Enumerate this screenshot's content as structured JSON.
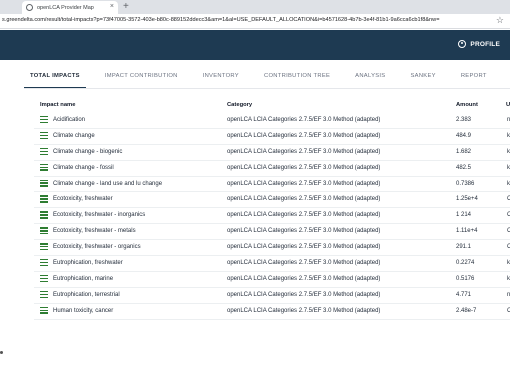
{
  "browser": {
    "tab_title": "openLCA Provider Map",
    "close_glyph": "×",
    "new_tab_glyph": "+",
    "url": "s.greendelta.com/result/total-impacts?p=73f47005-3572-403e-b80c-889152ddecc3&am=1&al=USE_DEFAULT_ALLOCATION&i=b4571628-4b7b-3e4f-81b1-9a6cca6cb1f8&nw=",
    "star_glyph": "☆"
  },
  "header": {
    "profile_label": "PROFILE"
  },
  "tabs": [
    {
      "label": "TOTAL IMPACTS",
      "active": true
    },
    {
      "label": "IMPACT CONTRIBUTION"
    },
    {
      "label": "INVENTORY"
    },
    {
      "label": "CONTRIBUTION TREE"
    },
    {
      "label": "ANALYSIS"
    },
    {
      "label": "SANKEY"
    },
    {
      "label": "REPORT"
    }
  ],
  "table": {
    "columns": [
      "Impact name",
      "Category",
      "Amount",
      "U"
    ],
    "rows": [
      {
        "name": "Acidification",
        "category": "openLCA LCIA Categories 2.7.5/EF 3.0 Method (adapted)",
        "amount": "2.383",
        "unit": "n"
      },
      {
        "name": "Climate change",
        "category": "openLCA LCIA Categories 2.7.5/EF 3.0 Method (adapted)",
        "amount": "484.9",
        "unit": "k"
      },
      {
        "name": "Climate change - biogenic",
        "category": "openLCA LCIA Categories 2.7.5/EF 3.0 Method (adapted)",
        "amount": "1.682",
        "unit": "k"
      },
      {
        "name": "Climate change - fossil",
        "category": "openLCA LCIA Categories 2.7.5/EF 3.0 Method (adapted)",
        "amount": "482.5",
        "unit": "k"
      },
      {
        "name": "Climate change - land use and lu change",
        "category": "openLCA LCIA Categories 2.7.5/EF 3.0 Method (adapted)",
        "amount": "0.7386",
        "unit": "k"
      },
      {
        "name": "Ecotoxicity, freshwater",
        "category": "openLCA LCIA Categories 2.7.5/EF 3.0 Method (adapted)",
        "amount": "1.25e+4",
        "unit": "C"
      },
      {
        "name": "Ecotoxicity, freshwater - inorganics",
        "category": "openLCA LCIA Categories 2.7.5/EF 3.0 Method (adapted)",
        "amount": "1 214",
        "unit": "C"
      },
      {
        "name": "Ecotoxicity, freshwater - metals",
        "category": "openLCA LCIA Categories 2.7.5/EF 3.0 Method (adapted)",
        "amount": "1.11e+4",
        "unit": "C"
      },
      {
        "name": "Ecotoxicity, freshwater - organics",
        "category": "openLCA LCIA Categories 2.7.5/EF 3.0 Method (adapted)",
        "amount": "291.1",
        "unit": "C"
      },
      {
        "name": "Eutrophication, freshwater",
        "category": "openLCA LCIA Categories 2.7.5/EF 3.0 Method (adapted)",
        "amount": "0.2274",
        "unit": "k"
      },
      {
        "name": "Eutrophication, marine",
        "category": "openLCA LCIA Categories 2.7.5/EF 3.0 Method (adapted)",
        "amount": "0.5176",
        "unit": "k"
      },
      {
        "name": "Eutrophication, terrestrial",
        "category": "openLCA LCIA Categories 2.7.5/EF 3.0 Method (adapted)",
        "amount": "4.771",
        "unit": "n"
      },
      {
        "name": "Human toxicity, cancer",
        "category": "openLCA LCIA Categories 2.7.5/EF 3.0 Method (adapted)",
        "amount": "2.48e-7",
        "unit": "C"
      }
    ]
  },
  "colors": {
    "appbar": "#1e3a52",
    "row_icon": "#2e7d32"
  },
  "icons": {
    "profile": "profile-icon",
    "row": "list-icon",
    "favicon": "globe-icon"
  }
}
